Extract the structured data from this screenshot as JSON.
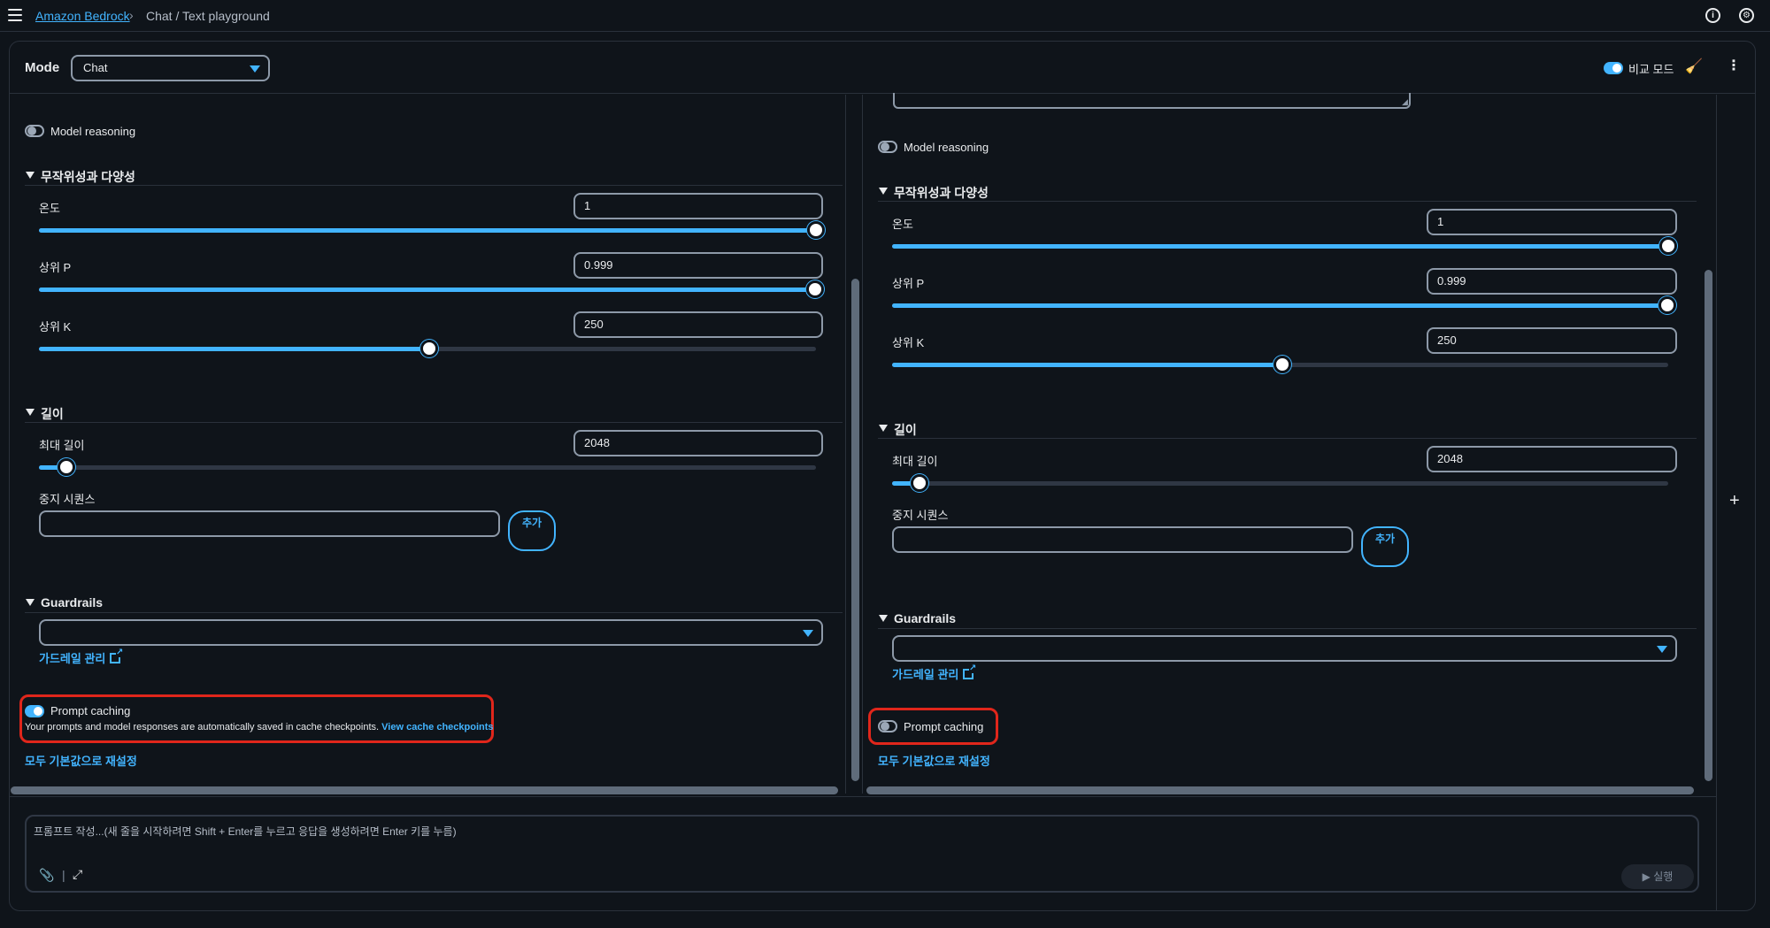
{
  "breadcrumb": {
    "root": "Amazon Bedrock",
    "current": "Chat / Text playground"
  },
  "header": {
    "mode_label": "Mode",
    "mode_value": "Chat",
    "compare_label": "비교 모드"
  },
  "panels": [
    {
      "model_reasoning": "Model reasoning",
      "section_random": "무작위성과 다양성",
      "temperature": {
        "label": "온도",
        "value": "1",
        "level": 1.0
      },
      "top_p": {
        "label": "상위 P",
        "value": "0.999",
        "level": 0.999
      },
      "top_k": {
        "label": "상위 K",
        "value": "250",
        "level": 0.5
      },
      "section_length": "길이",
      "max_length": {
        "label": "최대 길이",
        "value": "2048",
        "level": 0.035
      },
      "stop_sequence": {
        "label": "중지 시퀀스",
        "add_button": "추가"
      },
      "section_guardrails": "Guardrails",
      "guardrail_manage": "가드레일 관리",
      "prompt_caching": {
        "label": "Prompt caching",
        "enabled": true,
        "description": "Your prompts and model responses are automatically saved in cache checkpoints.",
        "link": "View cache checkpoints"
      },
      "reset_all": "모두 기본값으로 재설정"
    },
    {
      "model_reasoning": "Model reasoning",
      "section_random": "무작위성과 다양성",
      "temperature": {
        "label": "온도",
        "value": "1",
        "level": 1.0
      },
      "top_p": {
        "label": "상위 P",
        "value": "0.999",
        "level": 0.999
      },
      "top_k": {
        "label": "상위 K",
        "value": "250",
        "level": 0.5
      },
      "section_length": "길이",
      "max_length": {
        "label": "최대 길이",
        "value": "2048",
        "level": 0.035
      },
      "stop_sequence": {
        "label": "중지 시퀀스",
        "add_button": "추가"
      },
      "section_guardrails": "Guardrails",
      "guardrail_manage": "가드레일 관리",
      "prompt_caching": {
        "label": "Prompt caching",
        "enabled": false
      },
      "reset_all": "모두 기본값으로 재설정"
    }
  ],
  "prompt": {
    "placeholder": "프롬프트 작성...(새 줄을 시작하려면 Shift + Enter를 누르고 응답을 생성하려면 Enter 키를 누름)",
    "run_button": "실행"
  },
  "colors": {
    "accent": "#42b4ff",
    "highlight": "#e0261b",
    "background": "#0f141a"
  }
}
